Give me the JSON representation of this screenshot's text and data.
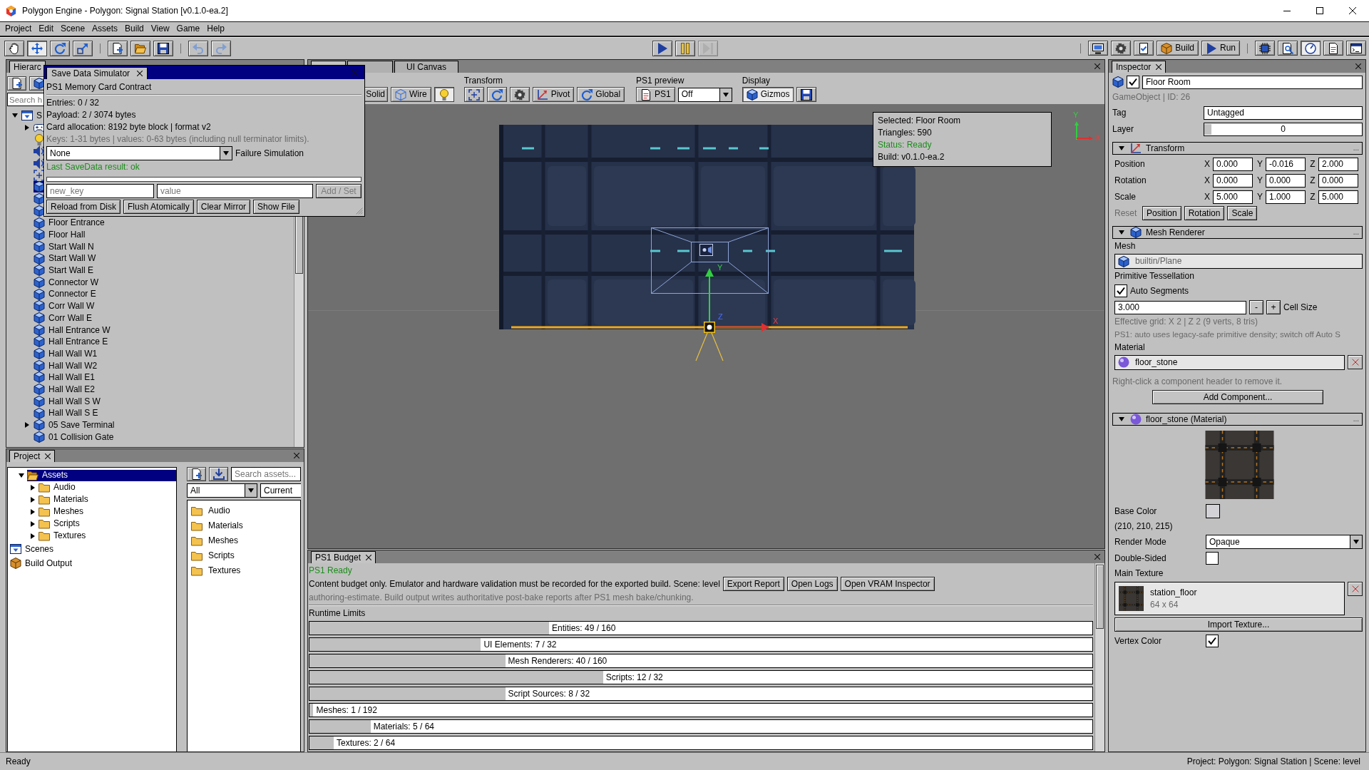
{
  "window": {
    "title": "Polygon Engine - Polygon: Signal Station [v0.1.0-ea.2]"
  },
  "menu": [
    "Project",
    "Edit",
    "Scene",
    "Assets",
    "Build",
    "View",
    "Game",
    "Help"
  ],
  "toolbar": {
    "groups": [
      {
        "buttons": [
          {
            "kind": "hand",
            "selected": false
          },
          {
            "kind": "move",
            "selected": true
          },
          {
            "kind": "rotate",
            "selected": false
          },
          {
            "kind": "scale",
            "selected": false
          }
        ]
      },
      {
        "buttons": [
          {
            "kind": "new"
          },
          {
            "kind": "open"
          },
          {
            "kind": "save"
          }
        ]
      },
      {
        "buttons": [
          {
            "kind": "undo"
          },
          {
            "kind": "redo"
          }
        ]
      }
    ],
    "playback": [
      {
        "kind": "play",
        "disabled": false
      },
      {
        "kind": "pause",
        "disabled": false
      },
      {
        "kind": "step",
        "disabled": true
      }
    ],
    "right_groups": [
      {
        "buttons": [
          {
            "kind": "monitor",
            "selected": false
          },
          {
            "kind": "gear",
            "selected": false
          },
          {
            "kind": "checklist",
            "selected": false
          },
          {
            "kind": "box",
            "label": "Build",
            "selected": false
          },
          {
            "kind": "play",
            "label": "Run",
            "selected": false
          }
        ]
      },
      {
        "buttons": [
          {
            "kind": "chip",
            "selected": false
          },
          {
            "kind": "inspect",
            "selected": false
          },
          {
            "kind": "gauge",
            "selected": true
          },
          {
            "kind": "document",
            "selected": false
          },
          {
            "kind": "terminal",
            "selected": false
          }
        ]
      }
    ]
  },
  "hierarchy": {
    "tab": "Hierarc",
    "toolbar": [
      {
        "kind": "new"
      },
      {
        "kind": "mesh"
      }
    ],
    "search": {
      "placeholder": "Search h"
    },
    "tree": [
      {
        "kind": "scene",
        "label": "S",
        "expanded": true,
        "selected": false,
        "children": [
          {
            "kind": "gamepad",
            "expanded": false,
            "selected": false
          },
          {
            "kind": "light",
            "selected": false
          },
          {
            "kind": "speaker",
            "selected": false
          },
          {
            "kind": "speaker",
            "selected": false
          },
          {
            "kind": "frame",
            "selected": false
          },
          {
            "kind": "mesh",
            "selected": true
          },
          {
            "kind": "mesh",
            "selected": false
          },
          {
            "kind": "mesh",
            "selected": false
          },
          {
            "kind": "mesh",
            "label": "Floor Entrance",
            "selected": false
          },
          {
            "kind": "mesh",
            "label": "Floor Hall",
            "selected": false
          },
          {
            "kind": "mesh",
            "label": "Start Wall N",
            "selected": false
          },
          {
            "kind": "mesh",
            "label": "Start Wall W",
            "selected": false
          },
          {
            "kind": "mesh",
            "label": "Start Wall E",
            "selected": false
          },
          {
            "kind": "mesh",
            "label": "Connector W",
            "selected": false
          },
          {
            "kind": "mesh",
            "label": "Connector E",
            "selected": false
          },
          {
            "kind": "mesh",
            "label": "Corr Wall W",
            "selected": false
          },
          {
            "kind": "mesh",
            "label": "Corr Wall E",
            "selected": false
          },
          {
            "kind": "mesh",
            "label": "Hall Entrance W",
            "selected": false
          },
          {
            "kind": "mesh",
            "label": "Hall Entrance E",
            "selected": false
          },
          {
            "kind": "mesh",
            "label": "Hall Wall W1",
            "selected": false
          },
          {
            "kind": "mesh",
            "label": "Hall Wall W2",
            "selected": false
          },
          {
            "kind": "mesh",
            "label": "Hall Wall E1",
            "selected": false
          },
          {
            "kind": "mesh",
            "label": "Hall Wall E2",
            "selected": false
          },
          {
            "kind": "mesh",
            "label": "Hall Wall S W",
            "selected": false
          },
          {
            "kind": "mesh",
            "label": "Hall Wall S E",
            "selected": false
          },
          {
            "kind": "mesh",
            "label": "05 Save Terminal",
            "expanded": false,
            "selected": false
          },
          {
            "kind": "mesh",
            "label": "01 Collision Gate",
            "selected": false
          }
        ]
      }
    ]
  },
  "save_simulator": {
    "tab": "Save Data Simulator",
    "heading": "PS1 Memory Card Contract",
    "stats": [
      "Entries: 0 / 32",
      "Payload: 2 / 3074 bytes",
      "Card allocation: 8192 byte block | format v2"
    ],
    "note": "Keys: 1-31 bytes | values: 0-63 bytes (including null terminator limits).",
    "failure": {
      "value": "None",
      "label": "Failure Simulation"
    },
    "result": "Last SaveData result: ok",
    "key_field": {
      "placeholder": "new_key"
    },
    "value_field": {
      "placeholder": "value"
    },
    "add_button": {
      "label": "Add / Set",
      "disabled": true
    },
    "buttons": [
      "Reload from Disk",
      "Flush Atomically",
      "Clear Mirror",
      "Show File"
    ]
  },
  "scene": {
    "tabs": [
      {
        "selected": true
      },
      {
        "selected": false
      },
      {
        "label": "UI Canvas",
        "selected": false
      }
    ]
  },
  "scene_toolbar": {
    "shading": [
      {
        "label": "Solid",
        "selected": false
      },
      {
        "kind": "wireframe",
        "label": "Wire",
        "selected": false
      },
      {
        "kind": "light",
        "selected": true
      }
    ],
    "groups": [
      {
        "label": "Transform",
        "buttons": [
          {
            "kind": "frame"
          },
          {
            "kind": "rotate"
          },
          {
            "kind": "gear"
          },
          {
            "kind": "axes",
            "label": "Pivot"
          },
          {
            "kind": "rotate",
            "label": "Global"
          }
        ]
      },
      {
        "label": "PS1 preview",
        "buttons": [
          {
            "kind": "document",
            "label": "PS1"
          },
          {
            "kind": "dropdown",
            "value": "Off"
          }
        ]
      },
      {
        "label": "Display",
        "buttons": [
          {
            "kind": "mesh",
            "label": "Gizmos",
            "selected": true
          },
          {
            "kind": "save"
          }
        ]
      }
    ]
  },
  "viewport": {
    "info": [
      {
        "kind": "text",
        "text": "Selected: Floor Room"
      },
      {
        "kind": "text",
        "text": "Triangles: 590"
      },
      {
        "kind": "status",
        "text": "Status: Ready"
      },
      {
        "kind": "text",
        "text": "Build: v0.1.0-ea.2"
      }
    ],
    "gizmo": {
      "y": "Y",
      "z": "Z",
      "x": "X"
    },
    "axes": {
      "y": "Y",
      "x": "X"
    }
  },
  "project": {
    "tab": "Project",
    "tree": [
      {
        "kind": "folder",
        "label": "Assets",
        "expanded": true,
        "selected": true,
        "children": [
          {
            "kind": "folder",
            "label": "Audio",
            "expanded": false,
            "selected": false
          },
          {
            "kind": "folder",
            "label": "Materials",
            "expanded": false,
            "selected": false
          },
          {
            "kind": "folder",
            "label": "Meshes",
            "expanded": false,
            "selected": false
          },
          {
            "kind": "folder",
            "label": "Scripts",
            "expanded": false,
            "selected": false
          },
          {
            "kind": "folder",
            "label": "Textures",
            "expanded": false,
            "selected": false
          }
        ]
      },
      {
        "kind": "scene",
        "label": "Scenes",
        "selected": false
      },
      {
        "kind": "box",
        "label": "Build Output",
        "selected": false
      }
    ],
    "toolbar": [
      {
        "kind": "new"
      },
      {
        "kind": "import"
      }
    ],
    "search": {
      "placeholder": "Search assets..."
    },
    "filter": {
      "value": "All"
    },
    "scope": {
      "value": "Current"
    },
    "files": [
      {
        "kind": "folder",
        "label": "Audio",
        "selected": false
      },
      {
        "kind": "folder",
        "label": "Materials",
        "selected": false
      },
      {
        "kind": "folder",
        "label": "Meshes",
        "selected": false
      },
      {
        "kind": "folder",
        "label": "Scripts",
        "selected": false
      },
      {
        "kind": "folder",
        "label": "Textures",
        "selected": false
      }
    ]
  },
  "budget": {
    "tab": "PS1 Budget",
    "status": "PS1 Ready",
    "description": "Content budget only. Emulator and hardware validation must be recorded for the exported build. Scene: level",
    "buttons": [
      "Export Report",
      "Open Logs",
      "Open VRAM Inspector"
    ],
    "note": "authoring-estimate. Build output writes authoritative post-bake reports after PS1 mesh bake/chunking.",
    "section": "Runtime Limits",
    "limits": [
      {
        "label": "Entities: 49 / 160",
        "level": 0.306
      },
      {
        "label": "UI Elements: 7 / 32",
        "level": 0.219
      },
      {
        "label": "Mesh Renderers: 40 / 160",
        "level": 0.25
      },
      {
        "label": "Scripts: 12 / 32",
        "level": 0.375
      },
      {
        "label": "Script Sources: 8 / 32",
        "level": 0.25
      },
      {
        "label": "Meshes: 1 / 192",
        "level": 0.005
      },
      {
        "label": "Materials: 5 / 64",
        "level": 0.078
      },
      {
        "label": "Textures: 2 / 64",
        "level": 0.031
      }
    ]
  },
  "inspector": {
    "tab": "Inspector",
    "object": {
      "kind": "mesh",
      "active": true,
      "name": "Floor Room",
      "info": "GameObject | ID: 26",
      "tag": {
        "label": "Tag",
        "value": "Untagged"
      },
      "layer": {
        "label": "Layer",
        "value": "0",
        "level": 0
      }
    },
    "transform": {
      "kind": "axes",
      "title": "Transform",
      "expanded": true,
      "more": "...",
      "rows": [
        {
          "label": "Position",
          "values": [
            {
              "axis": "X",
              "value": "0.000"
            },
            {
              "axis": "Y",
              "value": "-0.016"
            },
            {
              "axis": "Z",
              "value": "2.000"
            }
          ]
        },
        {
          "label": "Rotation",
          "values": [
            {
              "axis": "X",
              "value": "0.000"
            },
            {
              "axis": "Y",
              "value": "0.000"
            },
            {
              "axis": "Z",
              "value": "0.000"
            }
          ]
        },
        {
          "label": "Scale",
          "values": [
            {
              "axis": "X",
              "value": "5.000"
            },
            {
              "axis": "Y",
              "value": "1.000"
            },
            {
              "axis": "Z",
              "value": "5.000"
            }
          ]
        }
      ],
      "reset": {
        "label": "Reset",
        "buttons": [
          "Position",
          "Rotation",
          "Scale"
        ]
      }
    },
    "mesh_renderer": {
      "kind": "mesh",
      "title": "Mesh Renderer",
      "expanded": true,
      "more": "...",
      "mesh_label": "Mesh",
      "mesh": {
        "kind": "mesh",
        "value": "builtin/Plane",
        "disabled": true
      },
      "tessellation_label": "Primitive Tessellation",
      "auto_segments": {
        "label": "Auto Segments",
        "checked": true
      },
      "cell_size": {
        "value": "3.000",
        "decrement": "-",
        "increment": "+",
        "label": "Cell Size"
      },
      "grid_info": "Effective grid: X 2 | Z 2 (9 verts, 8 tris)",
      "hint": "PS1: auto uses legacy-safe primitive density; switch off Auto S",
      "material_label": "Material",
      "material": {
        "kind": "material",
        "value": "floor_stone",
        "disabled": false
      }
    },
    "remove_hint": "Right-click a component header to remove it.",
    "add_component": "Add Component...",
    "material": {
      "kind": "material",
      "title": "floor_stone (Material)",
      "expanded": true,
      "more": "...",
      "base_color": {
        "label": "Base Color",
        "color": "#d2d2d7",
        "value": "(210, 210, 215)"
      },
      "render_mode": {
        "label": "Render Mode",
        "value": "Opaque"
      },
      "double_sided": {
        "label": "Double-Sided",
        "checked": false
      },
      "main_texture": {
        "label": "Main Texture",
        "name": "station_floor",
        "size": "64 x 64"
      },
      "import_button": "Import Texture...",
      "vertex_color": {
        "label": "Vertex Color",
        "checked": true
      }
    }
  },
  "status_bar": {
    "left": "Ready",
    "right": "Project: Polygon: Signal Station | Scene: level"
  }
}
